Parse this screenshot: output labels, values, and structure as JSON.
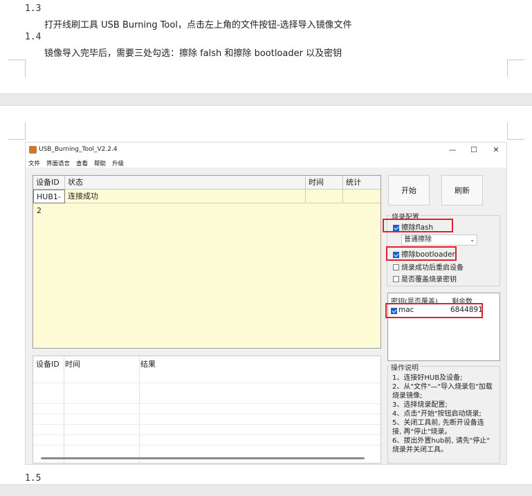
{
  "doc": {
    "items": [
      {
        "num": "1.3",
        "text": "打开线刷工具 USB Burning Tool，点击左上角的文件按钮-选择导入镜像文件"
      },
      {
        "num": "1.4",
        "text": "镜像导入完毕后，需要三处勾选：擦除 falsh 和擦除 bootloader 以及密钥"
      },
      {
        "num": "1.5",
        "text": ""
      }
    ]
  },
  "app": {
    "title": "USB_Burning_Tool_V2.2.4",
    "controls": {
      "minimize": "—",
      "maximize": "☐",
      "close": "✕"
    },
    "menu": [
      "文件",
      "界面语言",
      "查看",
      "帮助",
      "升级"
    ],
    "grid": {
      "headers": [
        "设备ID",
        "状态",
        "时间",
        "统计"
      ],
      "rows": [
        {
          "id": "HUB1-2",
          "status": "连接成功",
          "time": "",
          "count": ""
        }
      ]
    },
    "log_grid": {
      "headers": [
        "设备ID",
        "时间",
        "结果"
      ]
    },
    "buttons": {
      "start": "开始",
      "refresh": "刷新"
    },
    "config": {
      "label": "烧录配置",
      "erase_flash": "擦除flash",
      "erase_flash_checked": true,
      "erase_mode": "普通擦除",
      "erase_bootloader": "擦除bootloader",
      "erase_bootloader_checked": true,
      "reboot_after": "烧录成功后重启设备",
      "reboot_after_checked": false,
      "overwrite_key": "是否覆盖烧录密钥",
      "overwrite_key_checked": false
    },
    "keys": {
      "header_name": "密钥(是否覆盖)",
      "header_remaining": "剩余数",
      "rows": [
        {
          "name": "mac",
          "checked": true,
          "remaining": "6844891"
        }
      ]
    },
    "instructions": {
      "label": "操作说明",
      "lines": [
        "1、连接好HUB及设备;",
        "2、从\"文件\"—\"导入烧录包\"加载",
        "烧录镜像;",
        "3、选择烧录配置;",
        "4、点击\"开始\"按钮启动烧录;",
        "5、关闭工具前, 先断开设备连",
        "接, 再\"停止\"烧录。",
        "6、拔出外置hub前, 请先\"停止\"",
        "烧录并关闭工具。"
      ]
    }
  }
}
